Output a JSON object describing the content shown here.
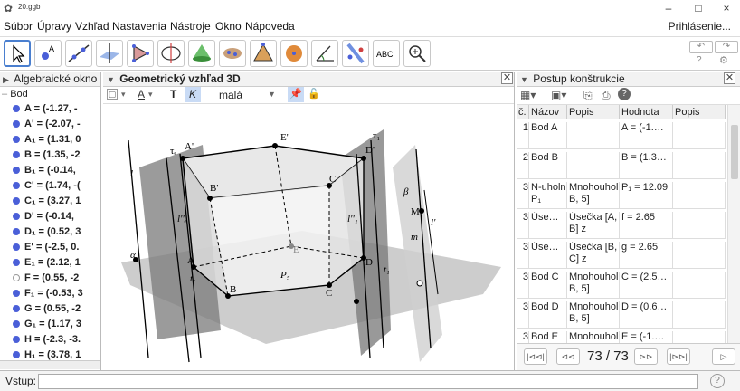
{
  "window": {
    "title": "20.ggb",
    "minimize": "–",
    "maximize": "□",
    "close": "×"
  },
  "menu": [
    "Súbor",
    "Úpravy",
    "Vzhľad",
    "Nastavenia",
    "Nástroje",
    "Okno",
    "Nápoveda"
  ],
  "login": "Prihlásenie...",
  "toolbar": {
    "tools": [
      "move-tool-icon",
      "point-tool-icon",
      "line-tool-icon",
      "perpendicular-tool-icon",
      "polygon-tool-icon",
      "circle-tool-icon",
      "intersect-surfaces-tool-icon",
      "conic-tool-icon",
      "pyramid-tool-icon",
      "sphere-tool-icon",
      "angle-tool-icon",
      "reflect-tool-icon",
      "text-tool-icon",
      "zoom-tool-icon"
    ],
    "text_tool_label": "ABC",
    "undo": "↶",
    "redo": "↷",
    "help": "?",
    "settings": "⚙"
  },
  "algebra": {
    "header": "Algebraické okno",
    "group": "Bod",
    "items": [
      {
        "label": "A = (-1.27, -",
        "hollow": false
      },
      {
        "label": "A' = (-2.07, -",
        "hollow": false
      },
      {
        "label": "A₁ = (1.31, 0",
        "hollow": false
      },
      {
        "label": "B = (1.35, -2",
        "hollow": false
      },
      {
        "label": "B₁ = (-0.14, ",
        "hollow": false
      },
      {
        "label": "C' = (1.74, -(",
        "hollow": false
      },
      {
        "label": "C₁ = (3.27, 1",
        "hollow": false
      },
      {
        "label": "D' = (-0.14, ",
        "hollow": false
      },
      {
        "label": "D₁ = (0.52, 3",
        "hollow": false
      },
      {
        "label": "E' = (-2.5, 0.",
        "hollow": false
      },
      {
        "label": "E₁ = (2.12, 1",
        "hollow": false
      },
      {
        "label": "F = (0.55, -2",
        "hollow": true
      },
      {
        "label": "F₁ = (-0.53, 3",
        "hollow": false
      },
      {
        "label": "G = (0.55, -2",
        "hollow": false
      },
      {
        "label": "G₁ = (1.17, 3",
        "hollow": false
      },
      {
        "label": "H = (-2.3, -3.",
        "hollow": false
      },
      {
        "label": "H₁ = (3.78, 1",
        "hollow": false
      }
    ]
  },
  "view3d": {
    "header": "Geometrický vzhľad 3D",
    "style_text_t": "T",
    "style_text_k": "K",
    "style_size": "malá",
    "labels": {
      "A": "A",
      "A_prime": "A'",
      "B": "B",
      "B_prime": "B'",
      "C": "C",
      "C_prime": "C'",
      "D": "D",
      "D_prime": "D'",
      "E": "E",
      "E_prime": "E'",
      "M": "M",
      "P5": "P₅",
      "alpha": "α",
      "beta": "β",
      "tau1": "τ₁",
      "tau_e": "τₑ",
      "t_e": "tₑ",
      "t1": "t₁",
      "l": "l",
      "l2e": "l''ₑ",
      "l21": "l''₁",
      "l_prime": "l'",
      "m": "m"
    }
  },
  "protocol": {
    "header": "Postup konštrukcie",
    "columns": [
      "č.",
      "Názov",
      "Popis",
      "Hodnota",
      "Popis"
    ],
    "rows": [
      {
        "n": "1",
        "name": "Bod A",
        "desc": "",
        "value": "A = (-1.…"
      },
      {
        "n": "2",
        "name": "Bod B",
        "desc": "",
        "value": "B = (1.3…"
      },
      {
        "n": "3",
        "name": "N-uholn P₁",
        "desc": "Mnohouhol B, 5]",
        "value": "P₁ = 12.09"
      },
      {
        "n": "3",
        "name": "Úse…",
        "desc": "Úsečka [A, B] z",
        "value": "f = 2.65"
      },
      {
        "n": "3",
        "name": "Úse…",
        "desc": "Úsečka [B, C] z",
        "value": "g = 2.65"
      },
      {
        "n": "3",
        "name": "Bod C",
        "desc": "Mnohouhol B, 5]",
        "value": "C = (2.5…"
      },
      {
        "n": "3",
        "name": "Bod D",
        "desc": "Mnohouhol B, 5]",
        "value": "D = (0.6…"
      },
      {
        "n": "3",
        "name": "Bod E",
        "desc": "Mnohouhol",
        "value": "E = (-1.…"
      }
    ],
    "nav_first": "|⊲⊲|",
    "nav_prev": "⊲⊲",
    "step": "73 / 73",
    "nav_next": "⊳⊳",
    "nav_last": "|⊳⊳|"
  },
  "input": {
    "label": "Vstup:",
    "value": "",
    "help": "?"
  }
}
